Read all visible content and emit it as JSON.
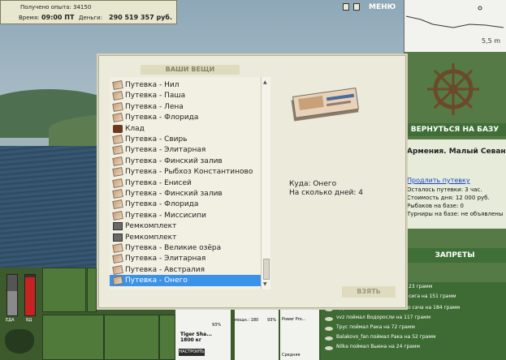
{
  "hud": {
    "experience_label": "Получено опыта: 34150",
    "time_label": "Время:",
    "time_value": "09:00 ПТ",
    "money_label": "Деньги:",
    "money_value": "290 519 357 руб.",
    "menu_label": "МЕНЮ"
  },
  "depth_graph": {
    "depth_label": "5,5 m"
  },
  "right_panel": {
    "return_button": "ВЕРНУТЬСЯ НА БАЗУ",
    "location_title": "Армения. Малый Севан",
    "extend_link": "Продлить путевку",
    "lines": [
      "Осталось путевки: 3 час.",
      "Стоимость дня: 12 000 руб.",
      "Рыбаков на базе: 0",
      "Турниры на базе: не объявлены"
    ],
    "bans_button": "ЗАПРЕТЫ"
  },
  "catch_feed": [
    "23 грамм",
    "сига на 151 грамм",
    "Трус поймал Обыкновенного сача на 184 грамм",
    "vvz поймал Водоросли на 117 грамм",
    "Трус поймал Рака на 72 грамм",
    "Balakovo_fan поймал Рака на 52 грамм",
    "Nilka поймал Выена на 24 грамм"
  ],
  "bottom_bar": {
    "gauge1_label": "ЕДА",
    "gauge2_label": "ВД",
    "rod_name": "Tiger Sha...",
    "rod_weight": "1800 кг",
    "rod_percent": "93%",
    "rod_line_info": "мощн.: 180",
    "rod_line_percent": "93%",
    "rod_lure": "Power Pro...",
    "lure_size": "Средняя",
    "setup_button": "НАСТРОИТЬ"
  },
  "dialog": {
    "title": "ВАШИ ВЕЩИ",
    "items": [
      {
        "label": "Путевка - Нил",
        "icon": "ticket"
      },
      {
        "label": "Путевка - Паша",
        "icon": "ticket"
      },
      {
        "label": "Путевка - Лена",
        "icon": "ticket"
      },
      {
        "label": "Путевка - Флорида",
        "icon": "ticket"
      },
      {
        "label": "Клад",
        "icon": "chest"
      },
      {
        "label": "Путевка - Свирь",
        "icon": "ticket"
      },
      {
        "label": "Путевка - Элитарная",
        "icon": "ticket"
      },
      {
        "label": "Путевка - Финский залив",
        "icon": "ticket"
      },
      {
        "label": "Путевка - Рыбхоз Константиново",
        "icon": "ticket"
      },
      {
        "label": "Путевка - Енисей",
        "icon": "ticket"
      },
      {
        "label": "Путевка - Финский залив",
        "icon": "ticket"
      },
      {
        "label": "Путевка - Флорида",
        "icon": "ticket"
      },
      {
        "label": "Путевка - Миссисипи",
        "icon": "ticket"
      },
      {
        "label": "Ремкомплект",
        "icon": "repair-kit"
      },
      {
        "label": "Ремкомплект",
        "icon": "repair-kit"
      },
      {
        "label": "Путевка - Великие озёра",
        "icon": "ticket"
      },
      {
        "label": "Путевка - Элитарная",
        "icon": "ticket"
      },
      {
        "label": "Путевка - Австралия",
        "icon": "ticket"
      },
      {
        "label": "Путевка - Онего",
        "icon": "ticket",
        "selected": true
      }
    ],
    "detail_where": "Куда: Онего",
    "detail_days": "На сколько дней: 4",
    "take_button": "ВЗЯТЬ"
  },
  "colors": {
    "selection": "#3b92e9",
    "dialog_bg": "#eceadb",
    "panel_green": "#3f6f36"
  }
}
